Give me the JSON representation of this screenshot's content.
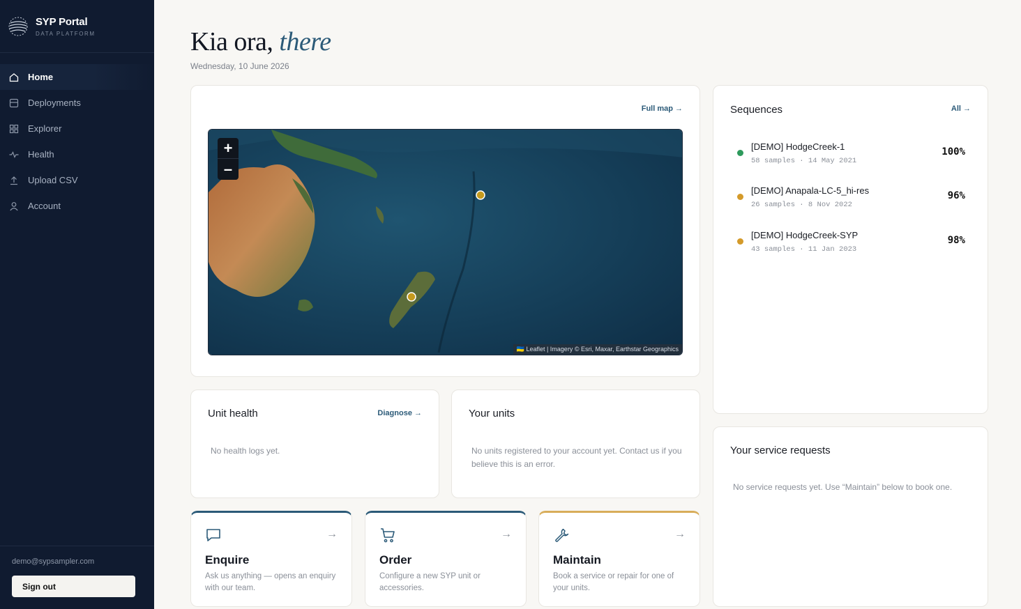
{
  "brand": {
    "title": "SYP Portal",
    "subtitle": "DATA PLATFORM"
  },
  "nav": [
    {
      "label": "Home",
      "icon": "home-icon"
    },
    {
      "label": "Deployments",
      "icon": "deployments-icon"
    },
    {
      "label": "Explorer",
      "icon": "grid-icon"
    },
    {
      "label": "Health",
      "icon": "pulse-icon"
    },
    {
      "label": "Upload CSV",
      "icon": "upload-icon"
    },
    {
      "label": "Account",
      "icon": "user-icon"
    }
  ],
  "user": {
    "email": "demo@sypsampler.com",
    "signout_label": "Sign out"
  },
  "greeting": {
    "prefix": "Kia ora,",
    "name": "there",
    "date": "Wednesday, 10 June 2026"
  },
  "map": {
    "link": "Full map →",
    "zoom_in": "+",
    "zoom_out": "–",
    "attribution": "🇺🇦 Leaflet | Imagery © Esri, Maxar, Earthstar Geographics"
  },
  "sequences": {
    "title": "Sequences",
    "link": "All →",
    "items": [
      {
        "name": "[DEMO] HodgeCreek-1",
        "meta": "58 samples · 14 May 2021",
        "pct": "100%",
        "color": "#2e9a5c"
      },
      {
        "name": "[DEMO] Anapala-LC-5_hi-res",
        "meta": "26 samples · 8 Nov 2022",
        "pct": "96%",
        "color": "#d49a2a"
      },
      {
        "name": "[DEMO] HodgeCreek-SYP",
        "meta": "43 samples · 11 Jan 2023",
        "pct": "98%",
        "color": "#d49a2a"
      }
    ]
  },
  "unit_health": {
    "title": "Unit health",
    "link": "Diagnose →",
    "empty": "No health logs yet."
  },
  "your_units": {
    "title": "Your units",
    "empty": "No units registered to your account yet. Contact us if you believe this is an error."
  },
  "service": {
    "title": "Your service requests",
    "empty": "No service requests yet. Use “Maintain” below to book one."
  },
  "actions": [
    {
      "title": "Enquire",
      "desc": "Ask us anything — opens an enquiry with our team.",
      "icon": "chat-icon",
      "arrow": "→"
    },
    {
      "title": "Order",
      "desc": "Configure a new SYP unit or accessories.",
      "icon": "cart-icon",
      "arrow": "→"
    },
    {
      "title": "Maintain",
      "desc": "Book a service or repair for one of your units.",
      "icon": "wrench-icon",
      "arrow": "→"
    }
  ],
  "colors": {
    "sidebar": "#101b30",
    "accent": "#2b5a78",
    "gold": "#d8ad5a",
    "marker": "#c49a1e"
  }
}
